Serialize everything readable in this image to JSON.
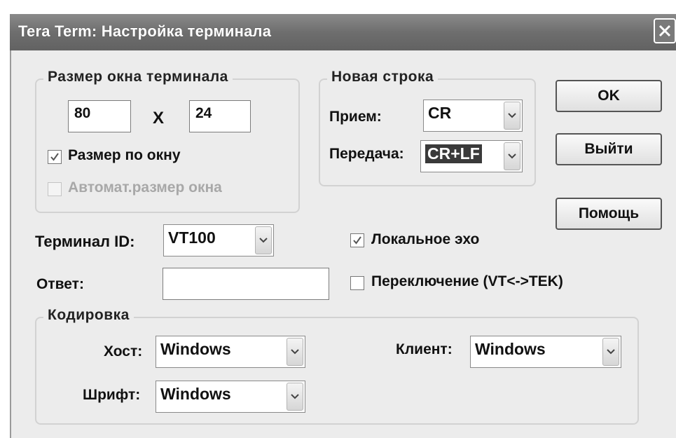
{
  "window": {
    "title": "Tera Term: Настройка терминала"
  },
  "size_group": {
    "legend": "Размер окна терминала",
    "cols": "80",
    "x_label": "X",
    "rows": "24",
    "fit_window_label": "Размер по окну",
    "fit_window_checked": true,
    "auto_size_label": "Автомат.размер окна",
    "auto_size_checked": false
  },
  "newline_group": {
    "legend": "Новая строка",
    "receive_label": "Прием:",
    "receive_value": "CR",
    "transmit_label": "Передача:",
    "transmit_value": "CR+LF"
  },
  "buttons": {
    "ok": "OK",
    "cancel": "Выйти",
    "help": "Помощь"
  },
  "terminal_id": {
    "label": "Терминал ID:",
    "value": "VT100"
  },
  "answerback": {
    "label": "Ответ:",
    "value": ""
  },
  "local_echo": {
    "label": "Локальное эхо",
    "checked": true
  },
  "auto_switch": {
    "label": "Переключение (VT<->TEK)",
    "checked": false
  },
  "encoding_group": {
    "legend": "Кодировка",
    "host_label": "Хост:",
    "host_value": "Windows",
    "client_label": "Клиент:",
    "client_value": "Windows",
    "font_label": "Шрифт:",
    "font_value": "Windows"
  },
  "icons": {
    "close": "close-icon",
    "dropdown": "chevron-down-icon",
    "check": "checkmark-icon"
  }
}
